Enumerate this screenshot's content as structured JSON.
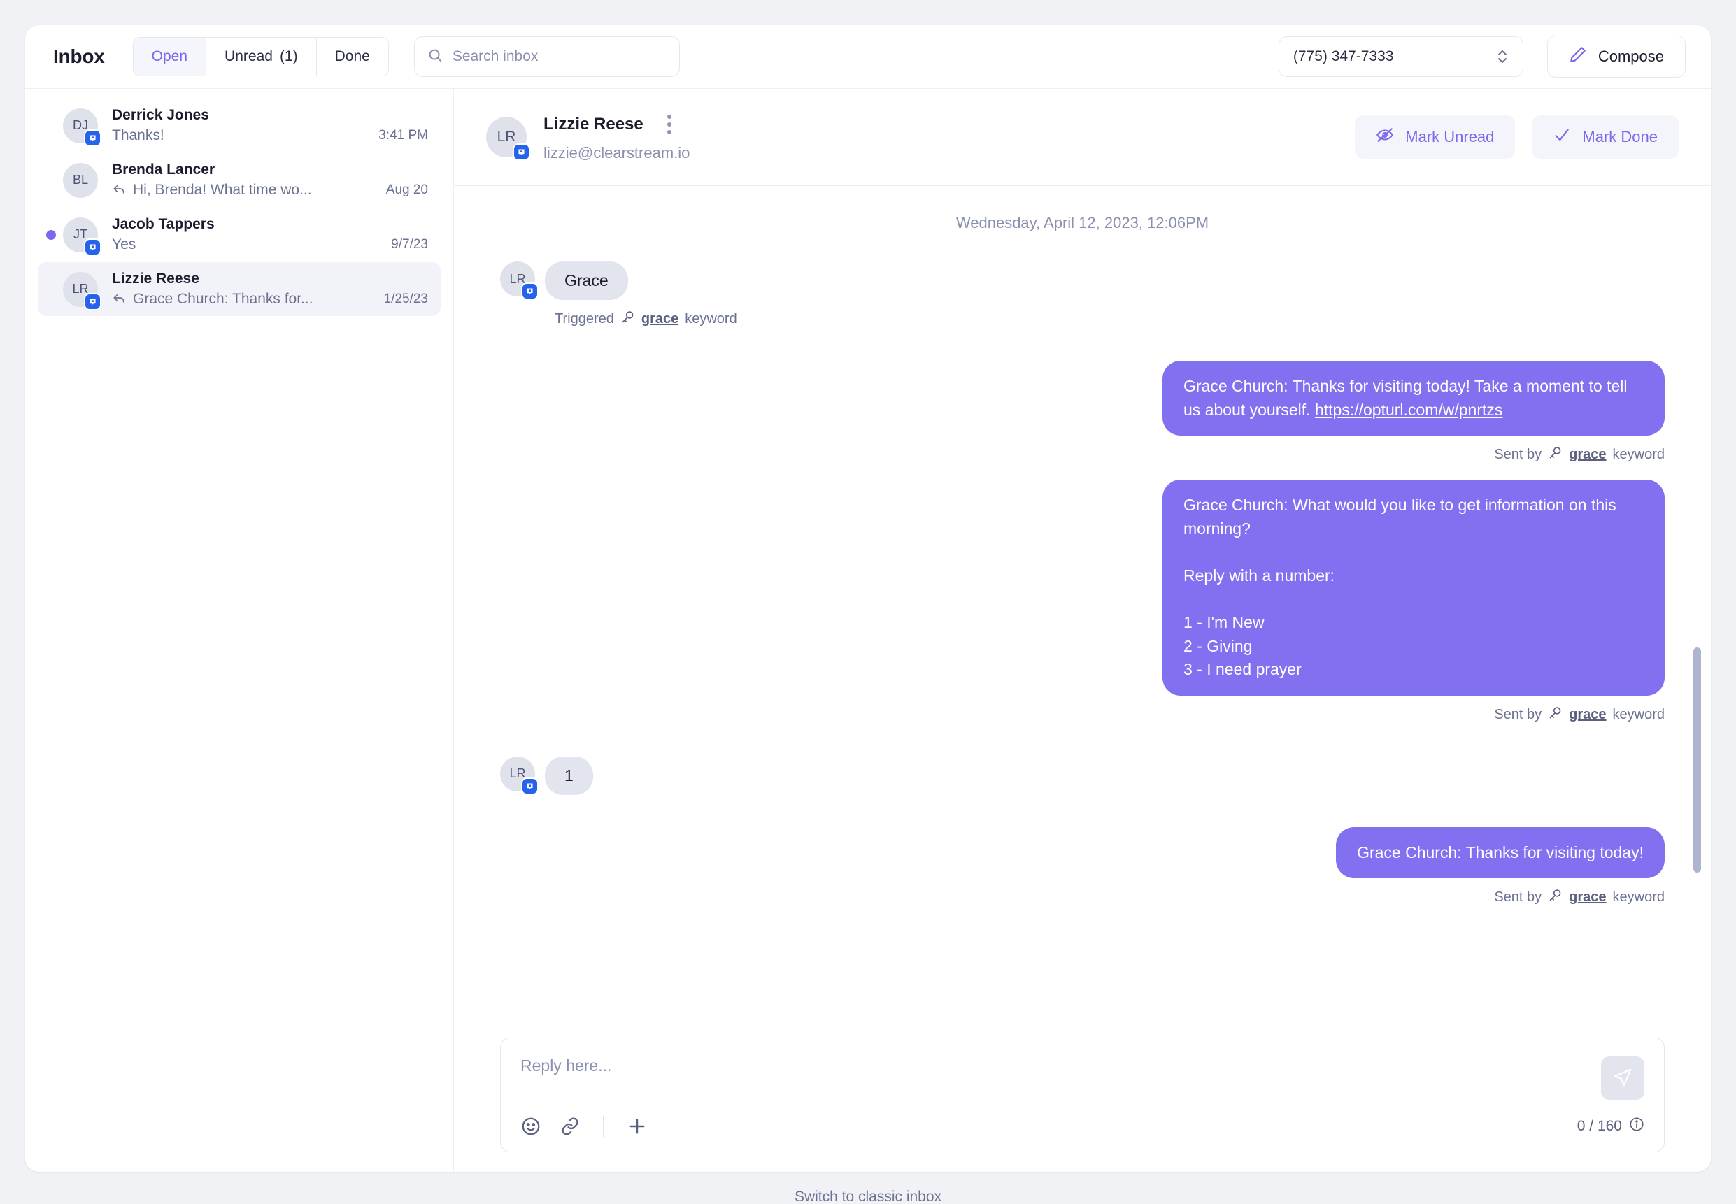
{
  "header": {
    "title": "Inbox",
    "tabs": [
      {
        "label": "Open",
        "count": "",
        "active": true
      },
      {
        "label": "Unread",
        "count": "(1)",
        "active": false
      },
      {
        "label": "Done",
        "count": "",
        "active": false
      }
    ],
    "search": {
      "placeholder": "Search inbox",
      "value": ""
    },
    "phone_select": {
      "value": "(775) 347-7333"
    },
    "compose_label": "Compose"
  },
  "conversations": [
    {
      "initials": "DJ",
      "name": "Derrick Jones",
      "preview": "Thanks!",
      "time": "3:41 PM",
      "unread": false,
      "replied": false,
      "selected": false,
      "badge": true
    },
    {
      "initials": "BL",
      "name": "Brenda Lancer",
      "preview": "Hi, Brenda! What time wo...",
      "time": "Aug 20",
      "unread": false,
      "replied": true,
      "selected": false,
      "badge": false
    },
    {
      "initials": "JT",
      "name": "Jacob Tappers",
      "preview": "Yes",
      "time": "9/7/23",
      "unread": true,
      "replied": false,
      "selected": false,
      "badge": true
    },
    {
      "initials": "LR",
      "name": "Lizzie Reese",
      "preview": "Grace Church: Thanks for...",
      "time": "1/25/23",
      "unread": false,
      "replied": true,
      "selected": true,
      "badge": true
    }
  ],
  "thread": {
    "initials": "LR",
    "name": "Lizzie Reese",
    "email": "lizzie@clearstream.io",
    "mark_unread_label": "Mark Unread",
    "mark_done_label": "Mark Done",
    "date_separator": "Wednesday, April 12, 2023, 12:06PM",
    "messages": [
      {
        "direction": "in",
        "initials": "LR",
        "text": "Grace",
        "meta_prefix": "Triggered",
        "meta_keyword": "grace",
        "meta_suffix": "keyword"
      },
      {
        "direction": "out",
        "text": "Grace Church: Thanks for visiting today! Take a moment to tell us about yourself. ",
        "link": "https://opturl.com/w/pnrtzs",
        "meta_prefix": "Sent by",
        "meta_keyword": "grace",
        "meta_suffix": "keyword"
      },
      {
        "direction": "out",
        "text": "Grace Church: What would you like to get information on this morning?\n\nReply with a number:\n\n1 - I'm New\n2 - Giving\n3 - I need prayer",
        "link": "",
        "meta_prefix": "Sent by",
        "meta_keyword": "grace",
        "meta_suffix": "keyword"
      },
      {
        "direction": "in",
        "initials": "LR",
        "text": "1",
        "meta_prefix": "",
        "meta_keyword": "",
        "meta_suffix": ""
      },
      {
        "direction": "out",
        "text": "Grace Church: Thanks for visiting today!",
        "link": "",
        "meta_prefix": "Sent by",
        "meta_keyword": "grace",
        "meta_suffix": "keyword"
      }
    ]
  },
  "composer": {
    "placeholder": "Reply here...",
    "value": "",
    "char_count": "0 / 160"
  },
  "footer": {
    "link_label": "Switch to classic inbox"
  },
  "colors": {
    "accent": "#7b68ee",
    "bubble_out": "#8171f0",
    "bubble_in": "#e2e4ee",
    "badge_blue": "#2563eb",
    "page_bg": "#f1f2f6"
  }
}
